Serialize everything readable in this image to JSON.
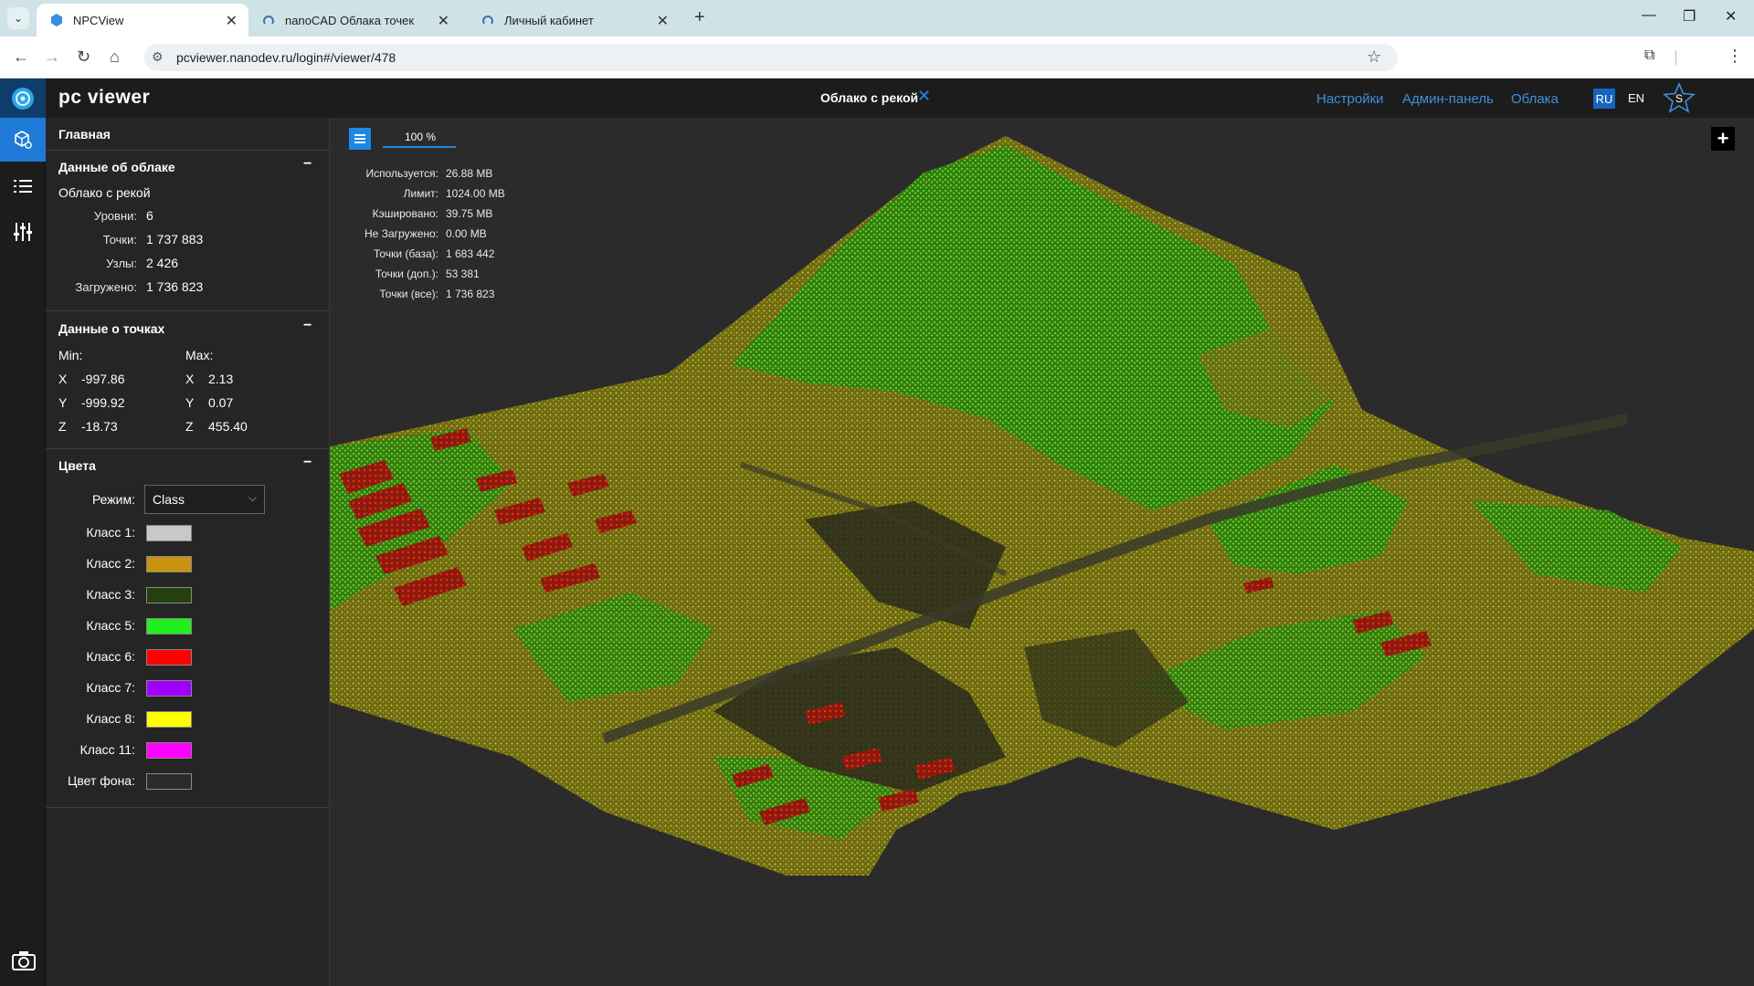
{
  "browser": {
    "tabs": [
      {
        "label": "NPCView"
      },
      {
        "label": "nanoCAD Облака точек"
      },
      {
        "label": "Личный кабинет"
      }
    ],
    "url": "pcviewer.nanodev.ru/login#/viewer/478"
  },
  "app": {
    "logo": "pc viewer",
    "cloud_title": "Облако с рекой",
    "nav": {
      "settings": "Настройки",
      "admin": "Админ-панель",
      "clouds": "Облака"
    },
    "lang_ru": "RU",
    "lang_en": "EN",
    "user_initial": "S"
  },
  "panel": {
    "main": "Главная",
    "cloud_info": {
      "title": "Данные об облаке",
      "name": "Облако с рекой",
      "rows": [
        {
          "label": "Уровни:",
          "value": "6"
        },
        {
          "label": "Точки:",
          "value": "1 737 883"
        },
        {
          "label": "Узлы:",
          "value": "2 426"
        },
        {
          "label": "Загружено:",
          "value": "1 736 823"
        }
      ]
    },
    "points_info": {
      "title": "Данные о точках",
      "min_label": "Min:",
      "max_label": "Max:",
      "min": [
        {
          "axis": "X",
          "value": "-997.86"
        },
        {
          "axis": "Y",
          "value": "-999.92"
        },
        {
          "axis": "Z",
          "value": "-18.73"
        }
      ],
      "max": [
        {
          "axis": "X",
          "value": "2.13"
        },
        {
          "axis": "Y",
          "value": "0.07"
        },
        {
          "axis": "Z",
          "value": "455.40"
        }
      ]
    },
    "colors": {
      "title": "Цвета",
      "mode_label": "Режим:",
      "mode_value": "Class",
      "classes": [
        {
          "label": "Класс 1:",
          "color": "#c8c8c8"
        },
        {
          "label": "Класс 2:",
          "color": "#c9930f"
        },
        {
          "label": "Класс 3:",
          "color": "#24400c"
        },
        {
          "label": "Класс 5:",
          "color": "#22f01e"
        },
        {
          "label": "Класс 6:",
          "color": "#ff0000"
        },
        {
          "label": "Класс 7:",
          "color": "#a100ff"
        },
        {
          "label": "Класс 8:",
          "color": "#ffff00"
        },
        {
          "label": "Класс 11:",
          "color": "#ff00ff"
        },
        {
          "label": "Цвет фона:",
          "color": "#2b2b2b"
        }
      ]
    }
  },
  "viewer": {
    "progress": "100 %",
    "stats": [
      {
        "label": "Используется:",
        "value": "26.88 MB"
      },
      {
        "label": "Лимит:",
        "value": "1024.00 MB"
      },
      {
        "label": "Кэшировано:",
        "value": "39.75 MB"
      },
      {
        "label": "Не Загружено:",
        "value": "0.00 MB"
      },
      {
        "label": "Точки (база):",
        "value": "1 683 442"
      },
      {
        "label": "Точки (доп.):",
        "value": "53 381"
      },
      {
        "label": "Точки (все):",
        "value": "1 736 823"
      }
    ],
    "plus": "+"
  }
}
